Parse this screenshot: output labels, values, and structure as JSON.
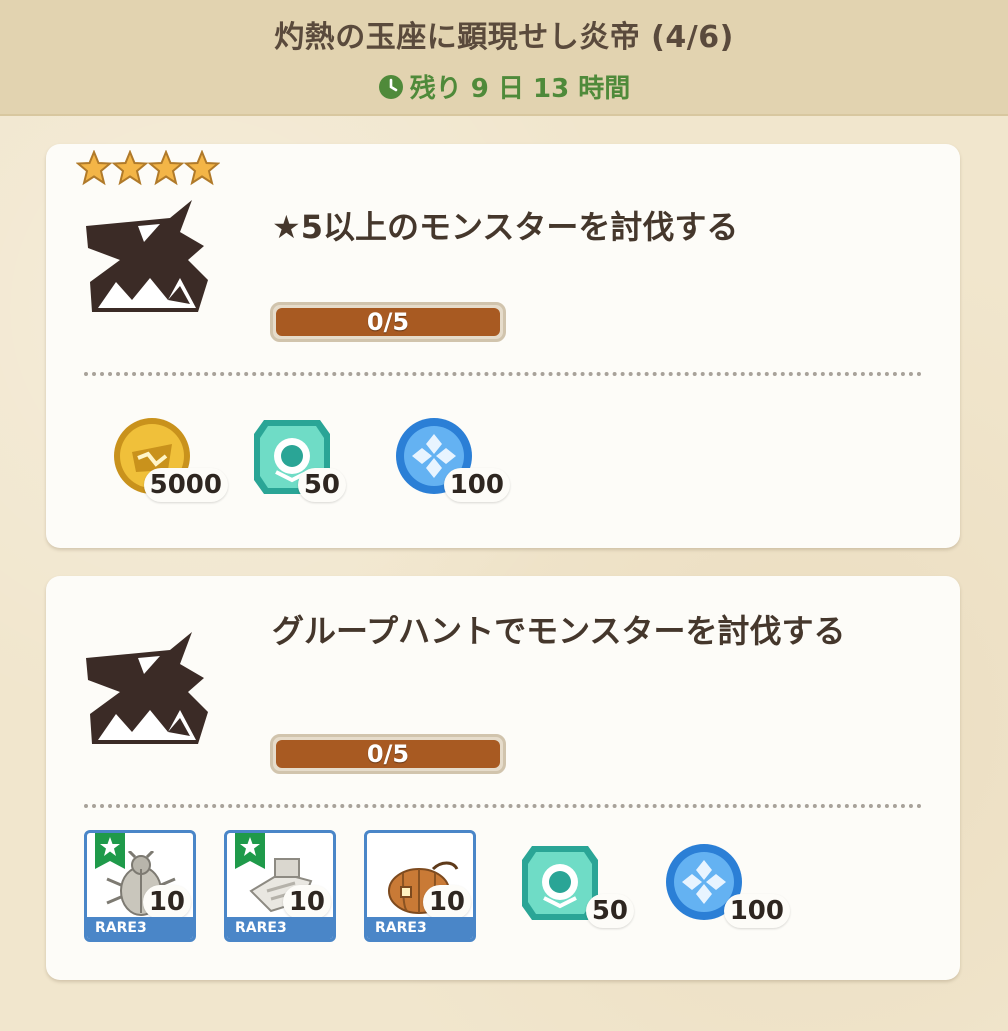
{
  "header": {
    "title": "灼熱の玉座に顕現せし炎帝 (4/6)",
    "remaining": "残り 9 日 13 時間"
  },
  "missions": [
    {
      "stars": 4,
      "title": "★5以上のモンスターを討伐する",
      "progress_text": "0/5",
      "progress_value": 0,
      "progress_max": 5,
      "rewards": [
        {
          "icon": "gold-coin-icon",
          "count": "5000"
        },
        {
          "icon": "green-emblem-gem-icon",
          "count": "50"
        },
        {
          "icon": "blue-orb-icon",
          "count": "100"
        }
      ]
    },
    {
      "title": "グループハントでモンスターを討伐する",
      "progress_text": "0/5",
      "progress_value": 0,
      "progress_max": 5,
      "materials": [
        {
          "icon": "beetle-material-icon",
          "rarity": "RARE3",
          "count": "10",
          "starred": true
        },
        {
          "icon": "bone-material-icon",
          "rarity": "RARE3",
          "count": "10",
          "starred": true
        },
        {
          "icon": "pumpkin-material-icon",
          "rarity": "RARE3",
          "count": "10",
          "starred": false
        }
      ],
      "rewards": [
        {
          "icon": "green-emblem-gem-icon",
          "count": "50"
        },
        {
          "icon": "blue-orb-icon",
          "count": "100"
        }
      ]
    }
  ],
  "colors": {
    "progress_fill": "#a85a22",
    "remaining_text": "#4f8a3a",
    "material_frame": "#4a86c8",
    "star_flag": "#1f9a4a"
  }
}
